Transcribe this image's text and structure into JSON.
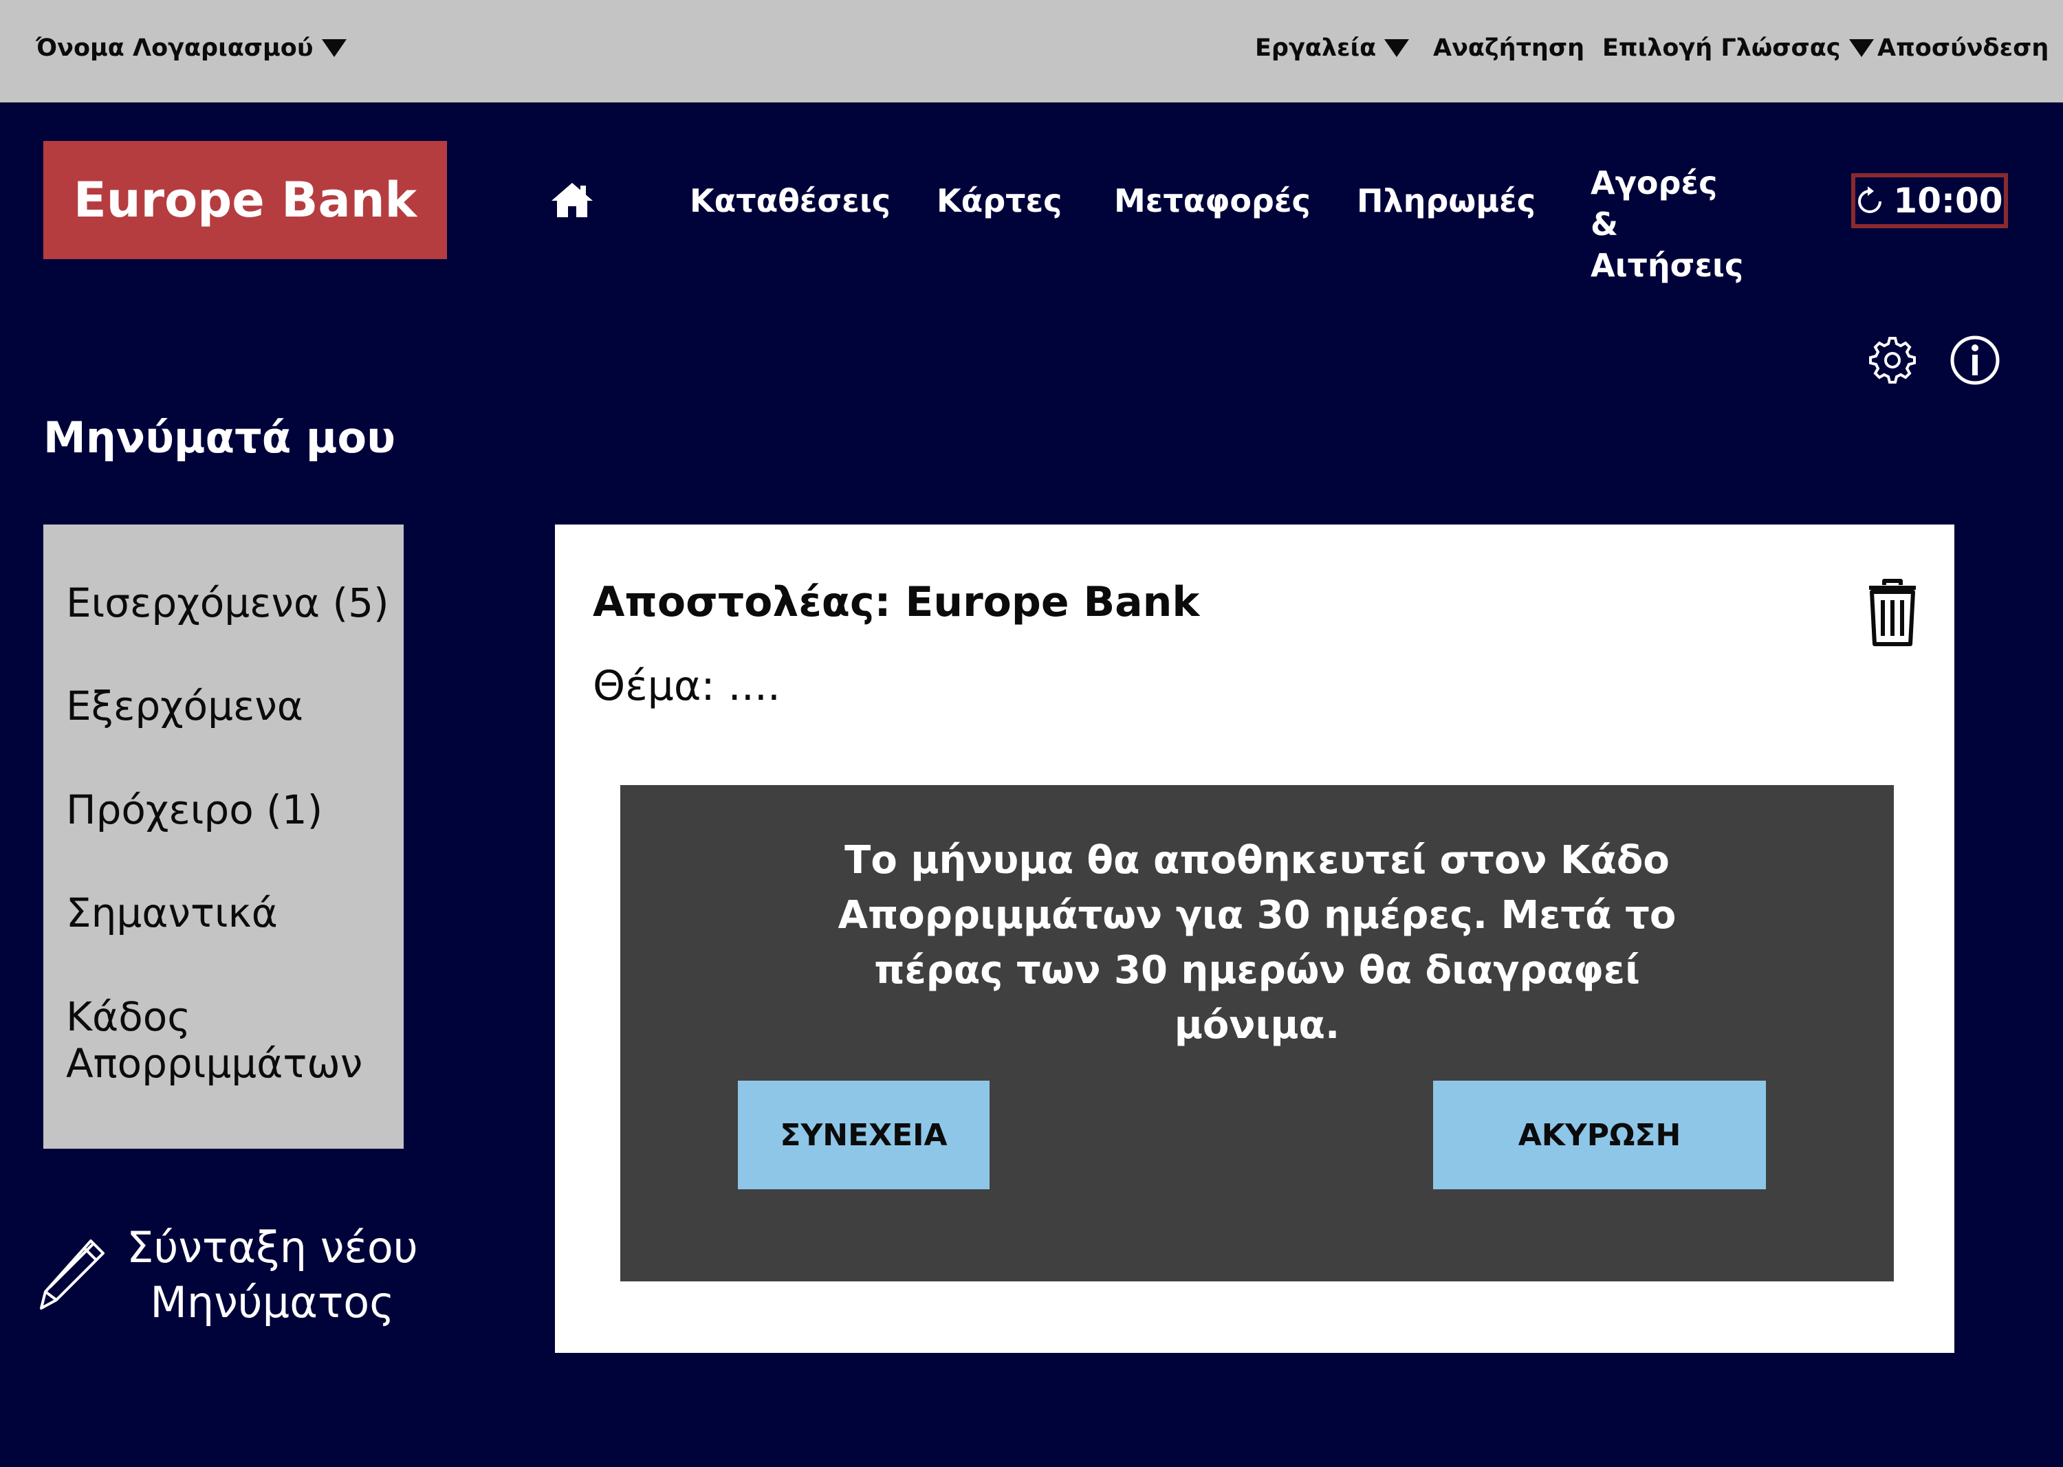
{
  "topbar": {
    "account_label": "Όνομα Λογαριασμού",
    "tools_label": "Εργαλεία",
    "search_label": "Αναζήτηση",
    "language_label": "Επιλογή Γλώσσας",
    "logout_label": "Αποσύνδεση"
  },
  "header": {
    "brand": "Europe Bank",
    "nav": [
      "Καταθέσεις",
      "Κάρτες",
      "Μεταφορές",
      "Πληρωμές",
      "Αγορές & Αιτήσεις"
    ],
    "home_icon": "home-icon",
    "session_timer": "10:00"
  },
  "page": {
    "title": "Μηνύματά μου"
  },
  "sidebar": {
    "folders": [
      {
        "label": "Εισερχόμενα (5)"
      },
      {
        "label": "Εξερχόμενα"
      },
      {
        "label": "Πρόχειρο (1)"
      },
      {
        "label": "Σημαντικά"
      },
      {
        "label": "Κάδος Απορριμμάτων"
      }
    ],
    "compose_label": "Σύνταξη νέου Μηνύματος"
  },
  "message": {
    "sender": "Αποστολέας: Europe Bank",
    "subject": "Θέμα: ...."
  },
  "dialog": {
    "text": "Το μήνυμα θα αποθηκευτεί στον Κάδο Απορριμμάτων για 30 ημέρες. Μετά το πέρας των 30 ημερών θα διαγραφεί μόνιμα.",
    "continue_label": "ΣΥΝΕΧΕΙΑ",
    "cancel_label": "ΑΚΥΡΩΣΗ"
  },
  "colors": {
    "background": "#00033a",
    "topbar": "#c4c4c4",
    "brand": "#b53d40",
    "timer_border": "#8b2a2e",
    "dialog": "#404040",
    "dialog_button": "#8ec6e8"
  }
}
